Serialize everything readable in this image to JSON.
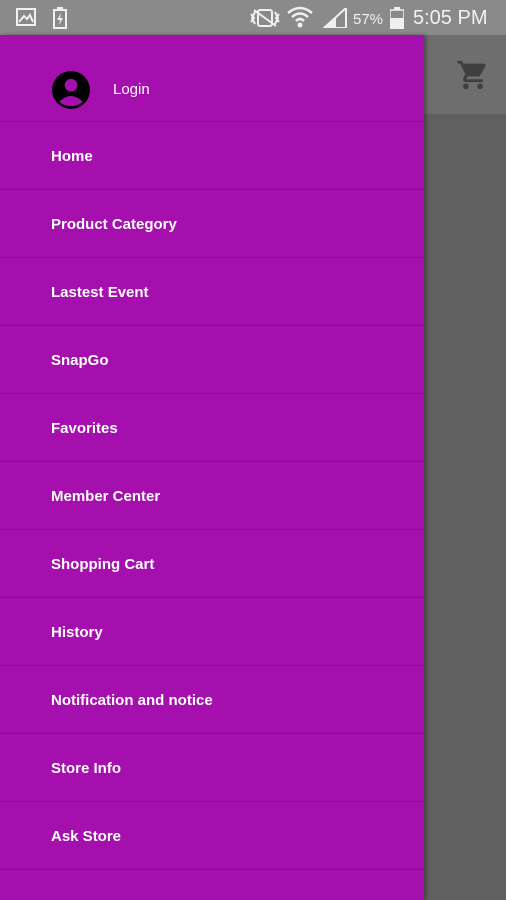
{
  "status_bar": {
    "left_icons": [
      "gallery-icon",
      "battery-saver-icon"
    ],
    "right_icons": [
      "vibrate-mute-icon",
      "wifi-icon",
      "signal-icon",
      "battery-icon"
    ],
    "battery": "57%",
    "time": "5:05 PM"
  },
  "app_bar": {
    "cart_icon": "shopping-cart-icon"
  },
  "drawer": {
    "header": {
      "avatar_icon": "account-circle-icon",
      "login_label": "Login"
    },
    "items": [
      {
        "label": "Home"
      },
      {
        "label": "Product Category"
      },
      {
        "label": "Lastest Event"
      },
      {
        "label": "SnapGo"
      },
      {
        "label": "Favorites"
      },
      {
        "label": "Member Center"
      },
      {
        "label": "Shopping Cart"
      },
      {
        "label": "History"
      },
      {
        "label": "Notification and notice"
      },
      {
        "label": "Store Info"
      },
      {
        "label": "Ask Store"
      }
    ]
  },
  "colors": {
    "drawer_background": "#a40fad",
    "divider": "#8d0b96",
    "scrim": "#5e5e5e",
    "status_bar": "#8a8a8a"
  }
}
